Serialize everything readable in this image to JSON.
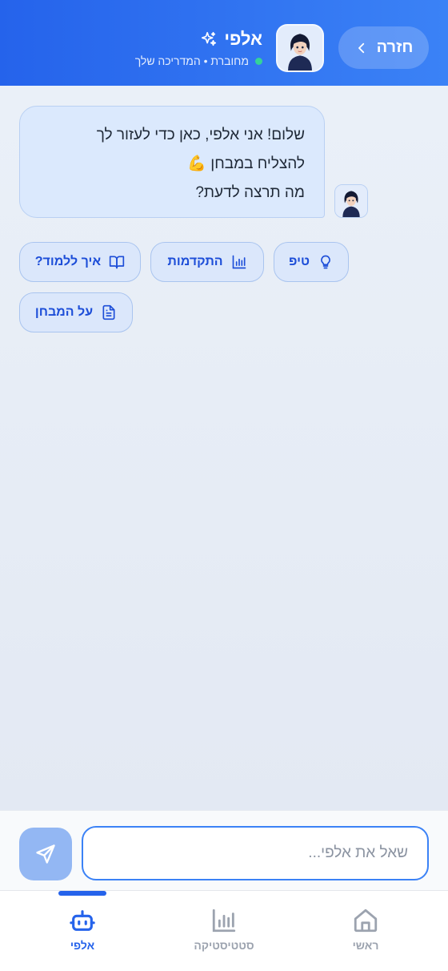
{
  "header": {
    "back_label": "חזרה",
    "title": "אלפי",
    "status": "מחוברת • המדריכה שלך",
    "accent_color": "#2563eb",
    "status_color": "#34d399"
  },
  "chat": {
    "messages": [
      {
        "sender": "bot",
        "lines": [
          "שלום! אני אלפי, כאן כדי לעזור לך",
          "להצליח במבחן 💪",
          "מה תרצה לדעת?"
        ]
      }
    ],
    "quick_replies": [
      {
        "label": "טיפ",
        "icon": "lightbulb-icon"
      },
      {
        "label": "התקדמות",
        "icon": "bar-chart-icon"
      },
      {
        "label": "איך ללמוד?",
        "icon": "book-icon"
      },
      {
        "label": "על המבחן",
        "icon": "document-icon"
      }
    ]
  },
  "input": {
    "placeholder": "שאל את אלפי...",
    "value": ""
  },
  "bottom_nav": {
    "items": [
      {
        "label": "ראשי",
        "icon": "home-icon",
        "active": false
      },
      {
        "label": "סטטיסטיקה",
        "icon": "stats-icon",
        "active": false
      },
      {
        "label": "אלפי",
        "icon": "robot-icon",
        "active": true
      }
    ]
  }
}
